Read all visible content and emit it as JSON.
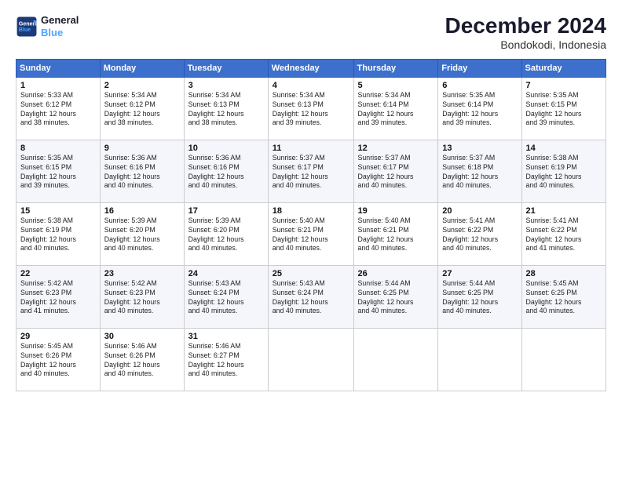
{
  "header": {
    "logo_line1": "General",
    "logo_line2": "Blue",
    "title": "December 2024",
    "subtitle": "Bondokodi, Indonesia"
  },
  "columns": [
    "Sunday",
    "Monday",
    "Tuesday",
    "Wednesday",
    "Thursday",
    "Friday",
    "Saturday"
  ],
  "weeks": [
    [
      {
        "day": "1",
        "info": "Sunrise: 5:33 AM\nSunset: 6:12 PM\nDaylight: 12 hours\nand 38 minutes."
      },
      {
        "day": "2",
        "info": "Sunrise: 5:34 AM\nSunset: 6:12 PM\nDaylight: 12 hours\nand 38 minutes."
      },
      {
        "day": "3",
        "info": "Sunrise: 5:34 AM\nSunset: 6:13 PM\nDaylight: 12 hours\nand 38 minutes."
      },
      {
        "day": "4",
        "info": "Sunrise: 5:34 AM\nSunset: 6:13 PM\nDaylight: 12 hours\nand 39 minutes."
      },
      {
        "day": "5",
        "info": "Sunrise: 5:34 AM\nSunset: 6:14 PM\nDaylight: 12 hours\nand 39 minutes."
      },
      {
        "day": "6",
        "info": "Sunrise: 5:35 AM\nSunset: 6:14 PM\nDaylight: 12 hours\nand 39 minutes."
      },
      {
        "day": "7",
        "info": "Sunrise: 5:35 AM\nSunset: 6:15 PM\nDaylight: 12 hours\nand 39 minutes."
      }
    ],
    [
      {
        "day": "8",
        "info": "Sunrise: 5:35 AM\nSunset: 6:15 PM\nDaylight: 12 hours\nand 39 minutes."
      },
      {
        "day": "9",
        "info": "Sunrise: 5:36 AM\nSunset: 6:16 PM\nDaylight: 12 hours\nand 40 minutes."
      },
      {
        "day": "10",
        "info": "Sunrise: 5:36 AM\nSunset: 6:16 PM\nDaylight: 12 hours\nand 40 minutes."
      },
      {
        "day": "11",
        "info": "Sunrise: 5:37 AM\nSunset: 6:17 PM\nDaylight: 12 hours\nand 40 minutes."
      },
      {
        "day": "12",
        "info": "Sunrise: 5:37 AM\nSunset: 6:17 PM\nDaylight: 12 hours\nand 40 minutes."
      },
      {
        "day": "13",
        "info": "Sunrise: 5:37 AM\nSunset: 6:18 PM\nDaylight: 12 hours\nand 40 minutes."
      },
      {
        "day": "14",
        "info": "Sunrise: 5:38 AM\nSunset: 6:19 PM\nDaylight: 12 hours\nand 40 minutes."
      }
    ],
    [
      {
        "day": "15",
        "info": "Sunrise: 5:38 AM\nSunset: 6:19 PM\nDaylight: 12 hours\nand 40 minutes."
      },
      {
        "day": "16",
        "info": "Sunrise: 5:39 AM\nSunset: 6:20 PM\nDaylight: 12 hours\nand 40 minutes."
      },
      {
        "day": "17",
        "info": "Sunrise: 5:39 AM\nSunset: 6:20 PM\nDaylight: 12 hours\nand 40 minutes."
      },
      {
        "day": "18",
        "info": "Sunrise: 5:40 AM\nSunset: 6:21 PM\nDaylight: 12 hours\nand 40 minutes."
      },
      {
        "day": "19",
        "info": "Sunrise: 5:40 AM\nSunset: 6:21 PM\nDaylight: 12 hours\nand 40 minutes."
      },
      {
        "day": "20",
        "info": "Sunrise: 5:41 AM\nSunset: 6:22 PM\nDaylight: 12 hours\nand 40 minutes."
      },
      {
        "day": "21",
        "info": "Sunrise: 5:41 AM\nSunset: 6:22 PM\nDaylight: 12 hours\nand 41 minutes."
      }
    ],
    [
      {
        "day": "22",
        "info": "Sunrise: 5:42 AM\nSunset: 6:23 PM\nDaylight: 12 hours\nand 41 minutes."
      },
      {
        "day": "23",
        "info": "Sunrise: 5:42 AM\nSunset: 6:23 PM\nDaylight: 12 hours\nand 40 minutes."
      },
      {
        "day": "24",
        "info": "Sunrise: 5:43 AM\nSunset: 6:24 PM\nDaylight: 12 hours\nand 40 minutes."
      },
      {
        "day": "25",
        "info": "Sunrise: 5:43 AM\nSunset: 6:24 PM\nDaylight: 12 hours\nand 40 minutes."
      },
      {
        "day": "26",
        "info": "Sunrise: 5:44 AM\nSunset: 6:25 PM\nDaylight: 12 hours\nand 40 minutes."
      },
      {
        "day": "27",
        "info": "Sunrise: 5:44 AM\nSunset: 6:25 PM\nDaylight: 12 hours\nand 40 minutes."
      },
      {
        "day": "28",
        "info": "Sunrise: 5:45 AM\nSunset: 6:25 PM\nDaylight: 12 hours\nand 40 minutes."
      }
    ],
    [
      {
        "day": "29",
        "info": "Sunrise: 5:45 AM\nSunset: 6:26 PM\nDaylight: 12 hours\nand 40 minutes."
      },
      {
        "day": "30",
        "info": "Sunrise: 5:46 AM\nSunset: 6:26 PM\nDaylight: 12 hours\nand 40 minutes."
      },
      {
        "day": "31",
        "info": "Sunrise: 5:46 AM\nSunset: 6:27 PM\nDaylight: 12 hours\nand 40 minutes."
      },
      {
        "day": "",
        "info": ""
      },
      {
        "day": "",
        "info": ""
      },
      {
        "day": "",
        "info": ""
      },
      {
        "day": "",
        "info": ""
      }
    ]
  ]
}
